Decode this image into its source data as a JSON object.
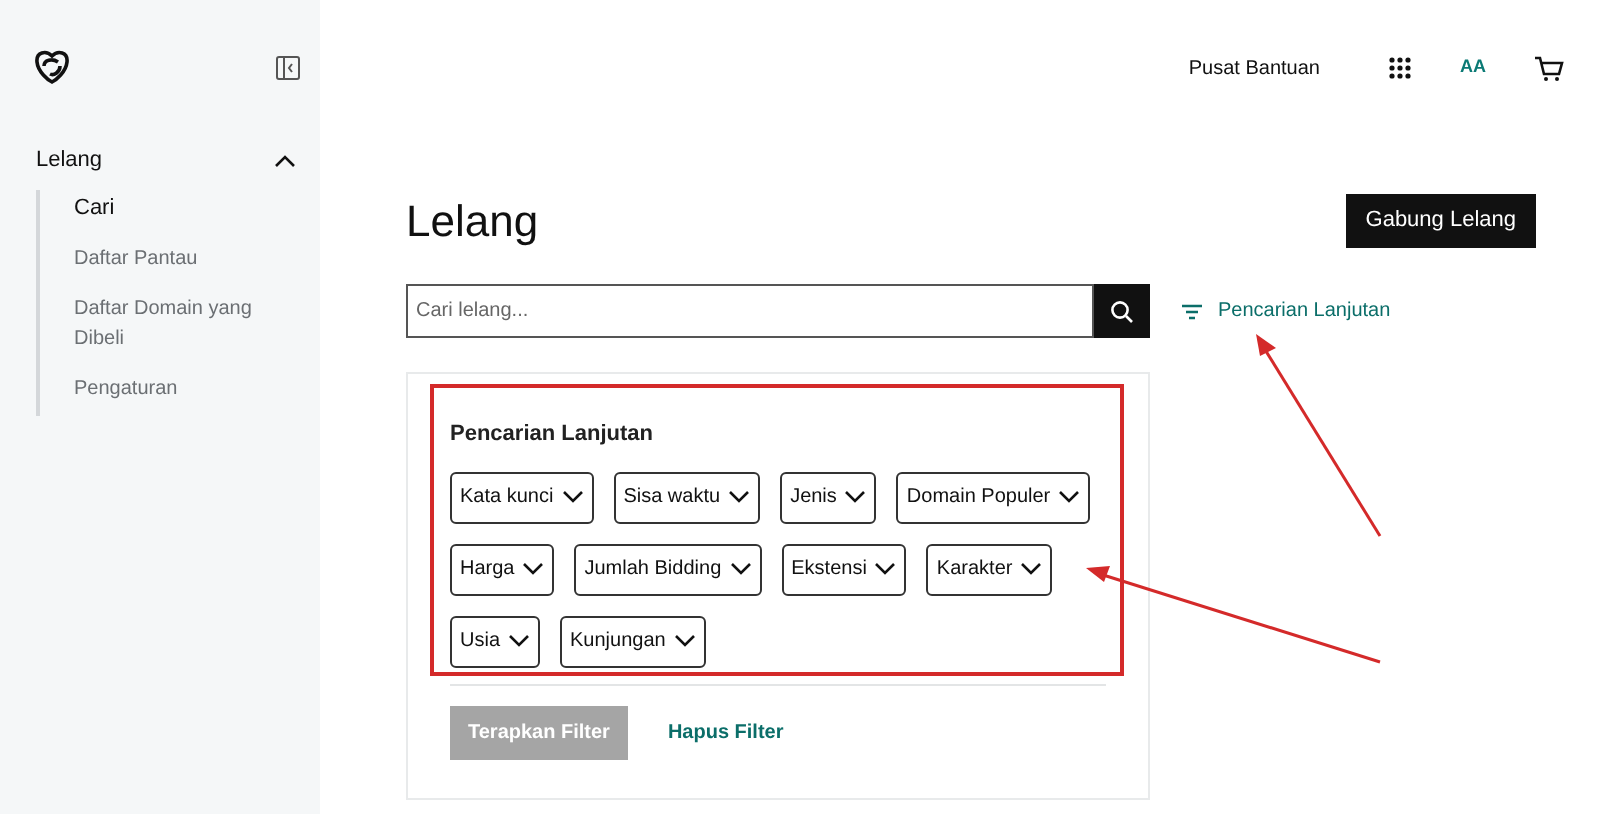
{
  "sidebar": {
    "section": {
      "label": "Lelang",
      "expanded": true,
      "items": [
        {
          "label": "Cari",
          "selected": true
        },
        {
          "label": "Daftar Pantau",
          "selected": false
        },
        {
          "label": "Daftar Domain yang Dibeli",
          "selected": false
        },
        {
          "label": "Pengaturan",
          "selected": false
        }
      ]
    }
  },
  "header": {
    "help": "Pusat Bantuan",
    "avatar": "AA"
  },
  "page": {
    "title": "Lelang",
    "join_button": "Gabung Lelang",
    "search": {
      "placeholder": "Cari lelang..."
    },
    "advanced_link": "Pencarian Lanjutan"
  },
  "filters": {
    "title": "Pencarian Lanjutan",
    "rows": [
      [
        "Kata kunci",
        "Sisa waktu",
        "Jenis",
        "Domain Populer"
      ],
      [
        "Harga",
        "Jumlah Bidding",
        "Ekstensi",
        "Karakter"
      ],
      [
        "Usia",
        "Kunjungan"
      ]
    ],
    "apply_button": {
      "label": "Terapkan Filter",
      "disabled": true
    },
    "clear_link": "Hapus Filter"
  }
}
